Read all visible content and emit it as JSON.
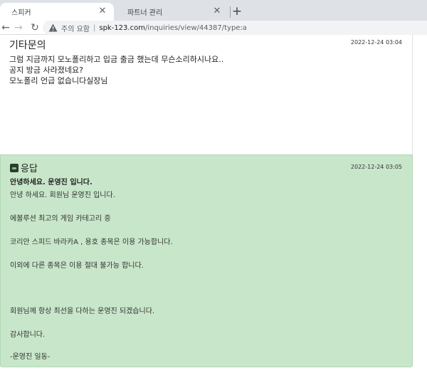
{
  "browser": {
    "tabs": [
      {
        "title": "스피커",
        "close": "✕"
      },
      {
        "title": "파트너 관리",
        "close": "✕"
      }
    ],
    "new_tab": "+",
    "nav": {
      "back": "←",
      "forward": "→",
      "reload": "↻"
    },
    "omnibox": {
      "security_label": "주의 요함",
      "separator": "|",
      "url_host": "spk-123.com",
      "url_path": "/inquiries/view/44387/type:a"
    }
  },
  "question": {
    "title": "기타문의",
    "date": "2022-12-24 03:04",
    "lines": [
      "그럼 지금까지 모노폴리하고 입금 출금 했는데 무슨소리하시나요..",
      "공지 방금 사라졌네요?",
      "모노폴리 언급 없습니다실장님"
    ]
  },
  "answer": {
    "title": "응답",
    "date": "2022-12-24 03:05",
    "greeting": "안녕하세요. 운영진 입니다.",
    "lines": [
      "안녕 하세요. 회원님 운영진 입니다.",
      "에볼루션 최고의 게임 카테고리 중",
      "코리안 스피드 바라카A , 용호  종목은 이용 가능합니다.",
      "이외에 다른 종목은 이용 절대 불가능 합니다.",
      "회원님께 항상 최선을 다하는 운영진 되겠습니다.",
      "감사합니다.",
      "-운영진 일동-"
    ]
  },
  "colors": {
    "answer_bg": "#c8e6c9",
    "tabstrip_bg": "#dee1e6",
    "warning": "#5f6368"
  }
}
